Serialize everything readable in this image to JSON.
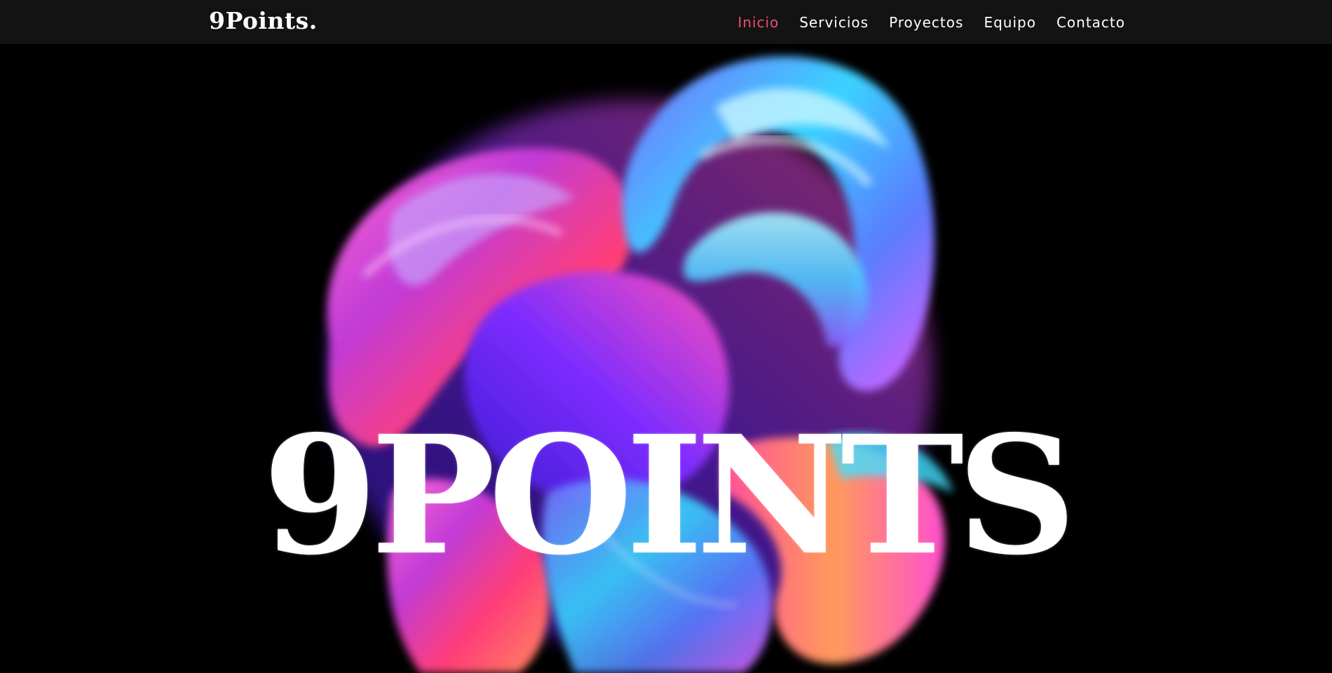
{
  "header": {
    "logo": "9Points."
  },
  "nav": {
    "items": [
      {
        "label": "Inicio",
        "active": true
      },
      {
        "label": "Servicios",
        "active": false
      },
      {
        "label": "Proyectos",
        "active": false
      },
      {
        "label": "Equipo",
        "active": false
      },
      {
        "label": "Contacto",
        "active": false
      }
    ]
  },
  "hero": {
    "title": "9POINTS"
  },
  "colors": {
    "accent": "#ef4d72",
    "navbar_bg": "#131313",
    "background": "#000000"
  }
}
